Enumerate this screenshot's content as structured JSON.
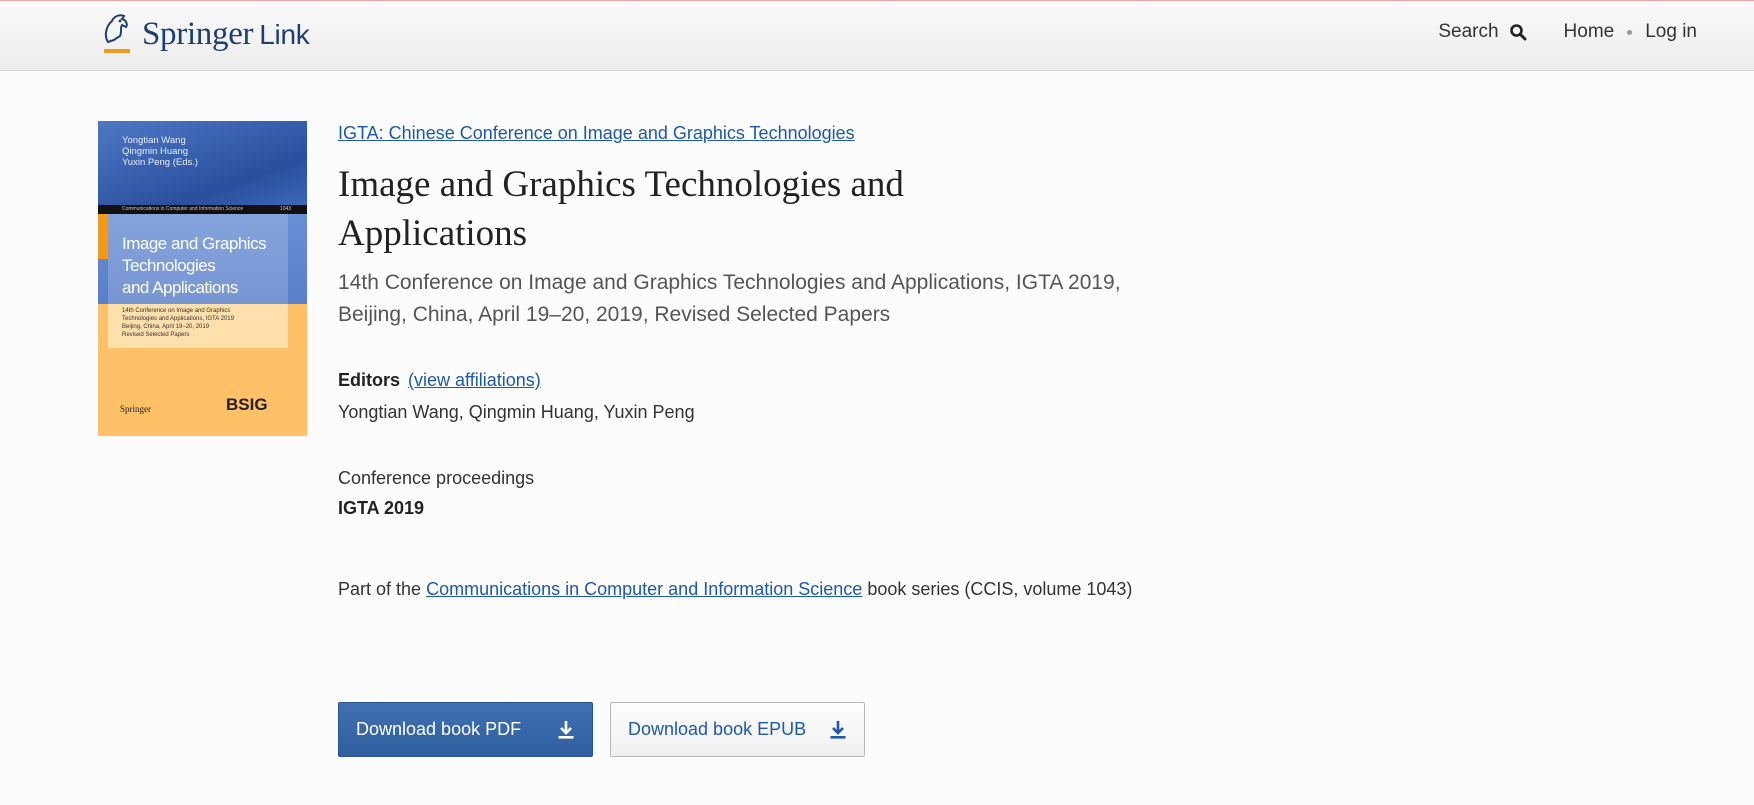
{
  "header": {
    "logo_text": "Springer",
    "logo_link_text": "Link",
    "search_label": "Search",
    "home_label": "Home",
    "login_label": "Log in"
  },
  "cover": {
    "authors": [
      "Yongtian Wang",
      "Qingmin Huang",
      "Yuxin Peng (Eds.)"
    ],
    "series_band": "Communications in Computer and Information Science",
    "volume": "1043",
    "title_lines": [
      "Image and Graphics",
      "Technologies",
      "and Applications"
    ],
    "subtitle_lines": [
      "14th Conference on Image and Graphics",
      "Technologies and Applications, IGTA 2019",
      "Beijing, China, April 19–20, 2019",
      "Revised Selected Papers"
    ],
    "publisher": "Springer",
    "partner": "BSIG"
  },
  "book": {
    "conference_link": "IGTA: Chinese Conference on Image and Graphics Technologies",
    "title": "Image and Graphics Technologies and Applications",
    "subtitle": "14th Conference on Image and Graphics Technologies and Applications, IGTA 2019, Beijing, China, April 19–20, 2019, Revised Selected Papers",
    "editors_label": "Editors",
    "view_affiliations": "(view affiliations)",
    "editors": "Yongtian Wang, Qingmin  Huang, Yuxin Peng",
    "proceedings_type": "Conference proceedings",
    "acronym": "IGTA 2019",
    "series_prefix": "Part of the",
    "series_name": "Communications in Computer and Information Science",
    "series_suffix": "book series (CCIS, volume 1043)"
  },
  "actions": {
    "download_pdf": "Download book PDF",
    "download_epub": "Download book EPUB"
  },
  "colors": {
    "link": "#1d59a8",
    "primary_button": "#3567a9",
    "brand": "#1d3f6e",
    "accent_orange": "#f19a1a"
  }
}
